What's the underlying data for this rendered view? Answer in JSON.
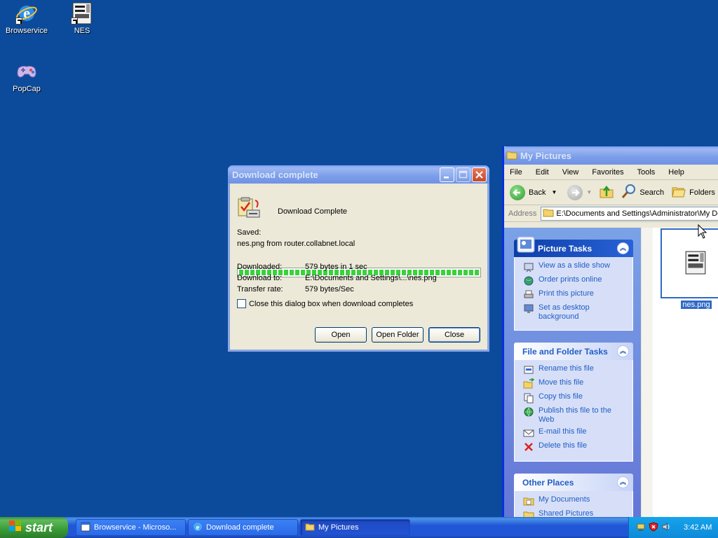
{
  "desktop": {
    "icons": [
      {
        "label": "Browservice"
      },
      {
        "label": "NES"
      },
      {
        "label": "PopCap"
      }
    ]
  },
  "download_dialog": {
    "title": "Download complete",
    "heading": "Download Complete",
    "saved_label": "Saved:",
    "saved_text": "nes.png from router.collabnet.local",
    "progress_percent": 100,
    "downloaded_label": "Downloaded:",
    "downloaded_value": "579 bytes in 1 sec",
    "download_to_label": "Download to:",
    "download_to_value": "E:\\Documents and Settings\\...\\nes.png",
    "transfer_rate_label": "Transfer rate:",
    "transfer_rate_value": "579 bytes/Sec",
    "checkbox_label": "Close this dialog box when download completes",
    "checkbox_checked": false,
    "buttons": {
      "open": "Open",
      "open_folder": "Open Folder",
      "close": "Close"
    }
  },
  "my_pictures": {
    "title": "My Pictures",
    "menu": [
      "File",
      "Edit",
      "View",
      "Favorites",
      "Tools",
      "Help"
    ],
    "toolbar": {
      "back": "Back",
      "search": "Search",
      "folders": "Folders"
    },
    "address_label": "Address",
    "address_value": "E:\\Documents and Settings\\Administrator\\My Documents\\My Pictures",
    "picture_tasks": {
      "title": "Picture Tasks",
      "items": [
        "View as a slide show",
        "Order prints online",
        "Print this picture",
        "Set as desktop background"
      ]
    },
    "file_folder_tasks": {
      "title": "File and Folder Tasks",
      "items": [
        "Rename this file",
        "Move this file",
        "Copy this file",
        "Publish this file to the Web",
        "E-mail this file",
        "Delete this file"
      ]
    },
    "other_places": {
      "title": "Other Places",
      "items": [
        "My Documents",
        "Shared Pictures"
      ]
    },
    "file": {
      "name": "nes.png"
    }
  },
  "taskbar": {
    "start_label": "start",
    "buttons": [
      "Browservice - Microso...",
      "Download complete",
      "My Pictures"
    ],
    "clock": "3:42 AM"
  }
}
